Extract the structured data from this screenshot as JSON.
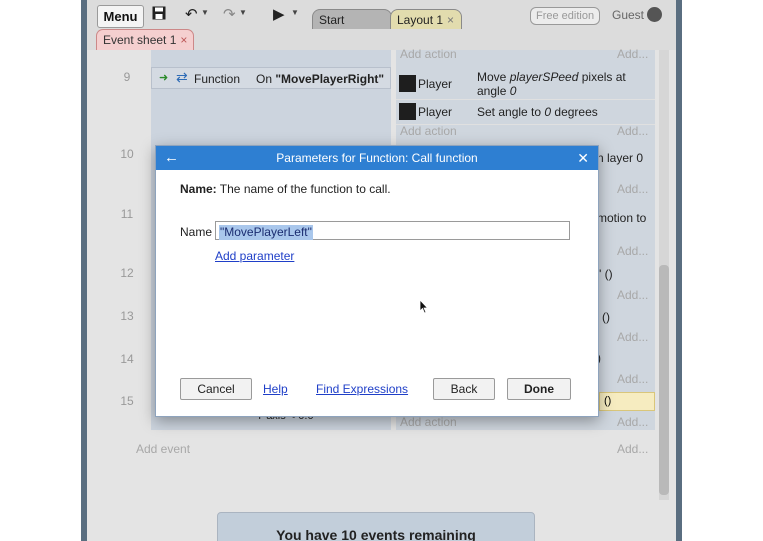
{
  "toolbar": {
    "menu_label": "Menu",
    "save_icon": "save-icon",
    "undo_icon": "undo-icon",
    "redo_icon": "redo-icon",
    "play_icon": "play-icon",
    "tabs": [
      {
        "label": "Start page",
        "close": "×"
      },
      {
        "label": "Layout 1",
        "close": "×"
      }
    ],
    "edition_badge": "Free edition",
    "user_label": "Guest"
  },
  "sheet_tab": {
    "label": "Event sheet 1",
    "close": "×"
  },
  "event_sheet": {
    "row_numbers": [
      "9",
      "10",
      "11",
      "12",
      "13",
      "14",
      "15"
    ],
    "event9": {
      "object": "Function",
      "condition_prefix": "On",
      "condition_value": "\"MovePlayerRight\""
    },
    "actions": [
      {
        "object": "Player",
        "text_parts": [
          "Move ",
          "playerSPeed",
          " pixels at angle ",
          "0"
        ]
      },
      {
        "object": "Player",
        "text_parts": [
          "Set angle to ",
          "0",
          " degrees"
        ]
      }
    ],
    "add_action": "Add action",
    "add_short": "Add...",
    "fragments": {
      "row10": "n layer 0",
      "row11": "motion to",
      "row12": "\" ()",
      "row13": "()",
      "row14": ")",
      "row15": "()",
      "row15_cond": "Y axis < 0.0"
    },
    "add_event": "Add event",
    "remaining_banner": "You have 10 events remaining"
  },
  "dialog": {
    "title": "Parameters for Function: Call function",
    "back_icon": "back-arrow-icon",
    "close": "✕",
    "description_label": "Name:",
    "description_text": " The name of the function to call.",
    "name_field_label": "Name",
    "name_field_value": "\"MovePlayerLeft\"",
    "add_parameter": "Add parameter",
    "buttons": {
      "cancel": "Cancel",
      "help": "Help",
      "find_expressions": "Find Expressions",
      "back": "Back",
      "done": "Done"
    }
  },
  "colors": {
    "dialog_title_bg": "#2e7fd2",
    "link": "#1f3fc8",
    "selection": "#a9c7ec",
    "sheet_tab": "#f5cfcf",
    "layout_tab": "#e2dcae"
  }
}
